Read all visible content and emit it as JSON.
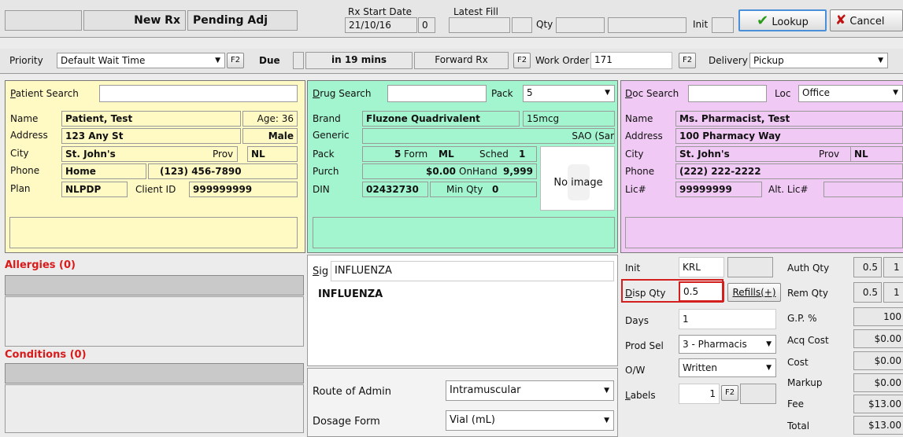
{
  "header": {
    "new_rx": "New Rx",
    "pending_adj": "Pending Adj",
    "rx_start_date_label": "Rx Start Date",
    "rx_start_date": "21/10/16",
    "rx_start_count": "0",
    "latest_fill_label": "Latest Fill",
    "qty_label": "Qty",
    "init_label": "Init",
    "lookup_label": "Lookup",
    "cancel_label": "Cancel"
  },
  "row2": {
    "priority_label": "Priority",
    "priority_value": "Default Wait Time",
    "f2": "F2",
    "due_label": "Due",
    "due_value": "in 19 mins",
    "forward_rx_label": "Forward Rx",
    "work_order_label": "Work Order",
    "work_order_value": "171",
    "delivery_label": "Delivery",
    "delivery_value": "Pickup"
  },
  "patient": {
    "search_label": "Patient Search",
    "name_label": "Name",
    "name": "Patient, Test",
    "age_label": "Age:",
    "age": "36",
    "address_label": "Address",
    "address": "123 Any St",
    "sex": "Male",
    "city_label": "City",
    "city": "St. John's",
    "prov_label": "Prov",
    "prov": "NL",
    "phone_label": "Phone",
    "phone_type": "Home",
    "phone": "(123) 456-7890",
    "plan_label": "Plan",
    "plan": "NLPDP",
    "client_id_label": "Client ID",
    "client_id": "999999999"
  },
  "allergies_label": "Allergies (0)",
  "conditions_label": "Conditions (0)",
  "drug": {
    "search_label": "Drug Search",
    "pack_label": "Pack",
    "pack_value": "5",
    "brand_label": "Brand",
    "brand": "Fluzone Quadrivalent",
    "strength": "15mcg",
    "generic_label": "Generic",
    "generic_tail": "SAO (Sar",
    "pack2_label": "Pack",
    "pack2": "5",
    "form_label": "Form",
    "form": "ML",
    "sched_label": "Sched",
    "sched": "1",
    "purch_label": "Purch",
    "purch": "$0.00",
    "onhand_label": "OnHand",
    "onhand": "9,999",
    "din_label": "DIN",
    "din": "02432730",
    "minqty_label": "Min Qty",
    "minqty": "0",
    "no_image": "No image"
  },
  "doc": {
    "search_label": "Doc Search",
    "loc_label": "Loc",
    "loc_value": "Office",
    "name_label": "Name",
    "name": "Ms. Pharmacist, Test",
    "address_label": "Address",
    "address": "100 Pharmacy Way",
    "city_label": "City",
    "city": "St. John's",
    "prov_label": "Prov",
    "prov": "NL",
    "phone_label": "Phone",
    "phone": "(222) 222-2222",
    "lic_label": "Lic#",
    "lic": "99999999",
    "alt_lic_label": "Alt. Lic#"
  },
  "sig": {
    "label": "Sig",
    "value": "INFLUENZA",
    "expanded": "INFLUENZA"
  },
  "admin": {
    "route_label": "Route of Admin",
    "route_value": "Intramuscular",
    "dosage_label": "Dosage Form",
    "dosage_value": "Vial (mL)"
  },
  "disp": {
    "init_label": "Init",
    "init_value": "KRL",
    "disp_qty_label": "Disp Qty",
    "disp_qty_value": "0.5",
    "refills_label": "Refills(+)",
    "days_label": "Days",
    "days_value": "1",
    "prod_sel_label": "Prod Sel",
    "prod_sel_value": "3 - Pharmacis",
    "ow_label": "O/W",
    "ow_value": "Written",
    "labels_label": "Labels",
    "labels_value": "1",
    "f2": "F2"
  },
  "pricing": {
    "auth_qty_label": "Auth Qty",
    "auth_qty": "0.5",
    "auth_qty2": "1",
    "rem_qty_label": "Rem Qty",
    "rem_qty": "0.5",
    "rem_qty2": "1",
    "gp_label": "G.P. %",
    "gp": "100",
    "acq_cost_label": "Acq Cost",
    "acq_cost": "$0.00",
    "cost_label": "Cost",
    "cost": "$0.00",
    "markup_label": "Markup",
    "markup": "$0.00",
    "fee_label": "Fee",
    "fee": "$13.00",
    "total_label": "Total",
    "total": "$13.00"
  },
  "colors": {
    "highlight_border": "#d41f1f",
    "lookup_check": "#2a9a1a",
    "cancel_x": "#c01010"
  }
}
